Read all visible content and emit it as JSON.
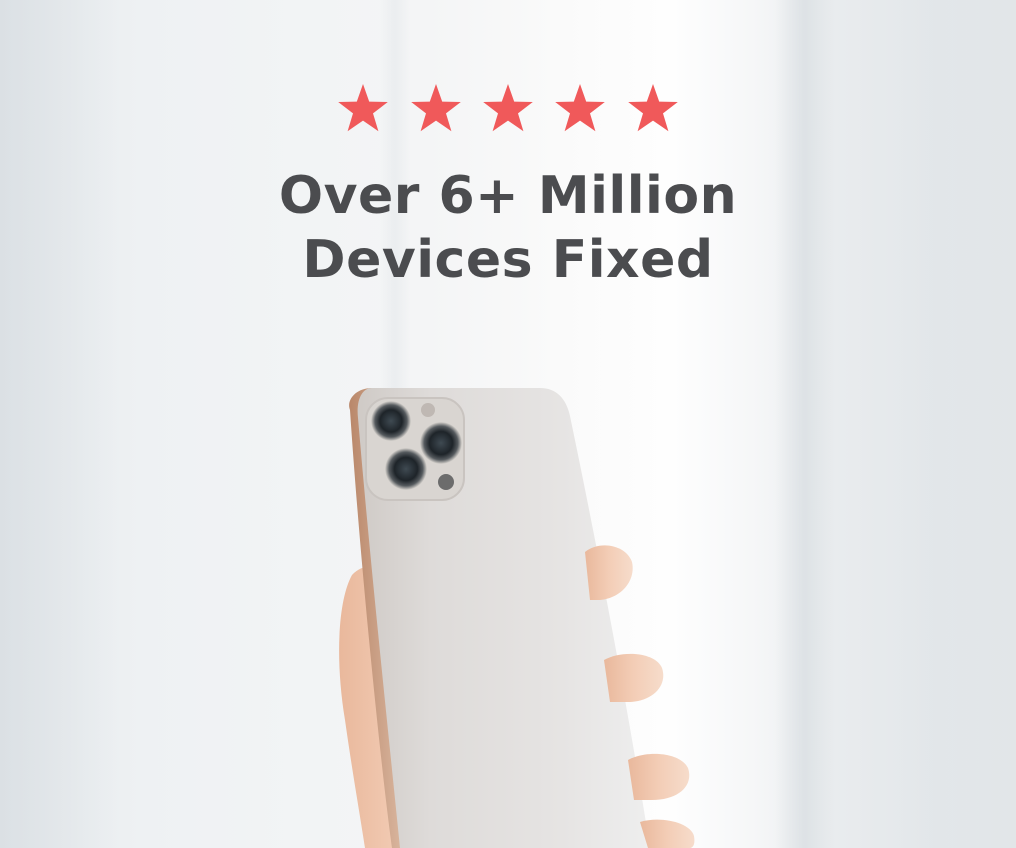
{
  "rating": {
    "stars": 5,
    "max_stars": 5,
    "star_color": "#f0595a"
  },
  "headline": {
    "line1": "Over 6+ Million",
    "line2": "Devices Fixed",
    "color": "#4b4c4f"
  },
  "image": {
    "icon": "hand-holding-phone-icon"
  }
}
